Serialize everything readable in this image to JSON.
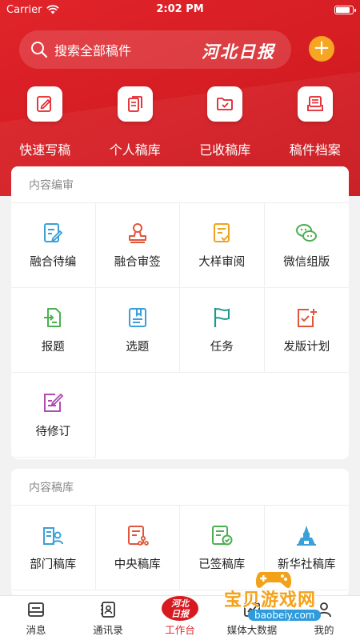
{
  "status_bar": {
    "carrier": "Carrier",
    "time": "2:02 PM"
  },
  "header": {
    "search_placeholder": "搜索全部稿件",
    "brand_logo": "河北日报",
    "add_label": "+"
  },
  "quick_actions": [
    {
      "label": "快速写稿",
      "icon": "pencil-icon"
    },
    {
      "label": "个人稿库",
      "icon": "documents-icon"
    },
    {
      "label": "已收稿库",
      "icon": "folder-icon"
    },
    {
      "label": "稿件档案",
      "icon": "archive-icon"
    }
  ],
  "content_review": {
    "title": "内容编审",
    "items": [
      {
        "label": "融合待编",
        "icon": "edit-doc-icon",
        "color": "#3aa0d8"
      },
      {
        "label": "融合审签",
        "icon": "stamp-icon",
        "color": "#e0563c"
      },
      {
        "label": "大样审阅",
        "icon": "check-doc-icon",
        "color": "#f0a21e"
      },
      {
        "label": "微信组版",
        "icon": "wechat-icon",
        "color": "#4caf50"
      },
      {
        "label": "报题",
        "icon": "submit-doc-icon",
        "color": "#4caf50"
      },
      {
        "label": "选题",
        "icon": "topic-doc-icon",
        "color": "#3aa0d8"
      },
      {
        "label": "任务",
        "icon": "flag-icon",
        "color": "#1e9a8a"
      },
      {
        "label": "发版计划",
        "icon": "plan-icon",
        "color": "#e0563c"
      },
      {
        "label": "待修订",
        "icon": "revise-icon",
        "color": "#b04bb5"
      }
    ]
  },
  "content_library": {
    "title": "内容稿库",
    "items": [
      {
        "label": "部门稿库",
        "icon": "dept-library-icon",
        "color": "#3aa0d8"
      },
      {
        "label": "中央稿库",
        "icon": "central-library-icon",
        "color": "#e0563c"
      },
      {
        "label": "已签稿库",
        "icon": "signed-library-icon",
        "color": "#4caf50"
      },
      {
        "label": "新华社稿库",
        "icon": "xinhua-library-icon",
        "color": "#3aa0d8"
      }
    ]
  },
  "tab_bar": {
    "tabs": [
      {
        "label": "消息",
        "icon": "message-icon"
      },
      {
        "label": "通讯录",
        "icon": "contacts-icon"
      },
      {
        "label": "工作台",
        "icon": "workbench-logo-icon",
        "logo_top": "河北",
        "logo_bottom": "日报"
      },
      {
        "label": "媒体大数据",
        "icon": "data-icon"
      },
      {
        "label": "我的",
        "icon": "profile-icon"
      }
    ]
  },
  "watermark": {
    "text": "宝贝游戏网",
    "url": "baobeiy.com"
  }
}
